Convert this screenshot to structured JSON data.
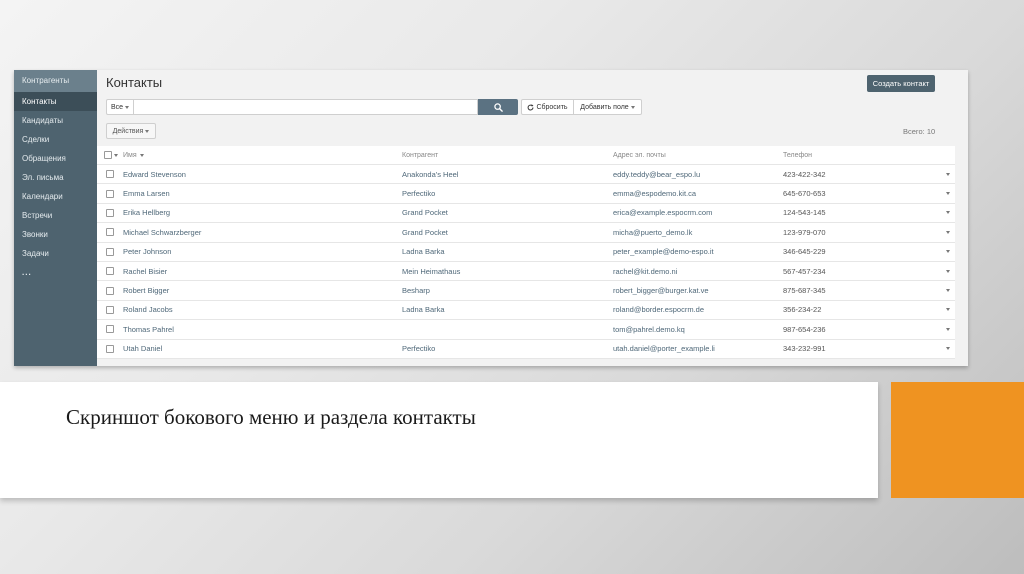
{
  "sidebar": {
    "items": [
      {
        "label": "Контрагенты"
      },
      {
        "label": "Контакты"
      },
      {
        "label": "Кандидаты"
      },
      {
        "label": "Сделки"
      },
      {
        "label": "Обращения"
      },
      {
        "label": "Эл. письма"
      },
      {
        "label": "Календари"
      },
      {
        "label": "Встречи"
      },
      {
        "label": "Звонки"
      },
      {
        "label": "Задачи"
      },
      {
        "label": "..."
      }
    ],
    "active_index": 1
  },
  "header": {
    "title": "Контакты",
    "create_button": "Создать контакт"
  },
  "search": {
    "filter": "Все",
    "value": "",
    "placeholder": "",
    "reset_label": "Сбросить",
    "add_field_label": "Добавить поле"
  },
  "actions_label": "Действия",
  "total_label": "Всего: 10",
  "table": {
    "columns": [
      "Имя",
      "Контрагент",
      "Адрес эл. почты",
      "Телефон"
    ],
    "rows": [
      {
        "name": "Edward Stevenson",
        "account": "Anakonda's Heel",
        "email": "eddy.teddy@bear_espo.lu",
        "phone": "423-422-342"
      },
      {
        "name": "Emma Larsen",
        "account": "Perfectiko",
        "email": "emma@espodemo.kit.ca",
        "phone": "645-670-653"
      },
      {
        "name": "Erika Hellberg",
        "account": "Grand Pocket",
        "email": "erica@example.espocrm.com",
        "phone": "124-543-145"
      },
      {
        "name": "Michael Schwarzberger",
        "account": "Grand Pocket",
        "email": "micha@puerto_demo.lk",
        "phone": "123-979-070"
      },
      {
        "name": "Peter Johnson",
        "account": "Ladna Barka",
        "email": "peter_example@demo-espo.it",
        "phone": "346-645-229"
      },
      {
        "name": "Rachel Bisier",
        "account": "Mein Heimathaus",
        "email": "rachel@kit.demo.ni",
        "phone": "567-457-234"
      },
      {
        "name": "Robert Bigger",
        "account": "Besharp",
        "email": "robert_bigger@burger.kat.ve",
        "phone": "875-687-345"
      },
      {
        "name": "Roland Jacobs",
        "account": "Ladna Barka",
        "email": "roland@border.espocrm.de",
        "phone": "356-234-22"
      },
      {
        "name": "Thomas Pahrel",
        "account": "",
        "email": "tom@pahrel.demo.kq",
        "phone": "987-654-236"
      },
      {
        "name": "Utah Daniel",
        "account": "Perfectiko",
        "email": "utah.daniel@porter_example.li",
        "phone": "343-232-991"
      }
    ]
  },
  "caption": "Скриншот бокового меню и раздела контакты",
  "colors": {
    "sidebar": "#4e636f",
    "sidebar_active": "#3c4e58",
    "primary_button": "#4e636f",
    "link": "#4f6879",
    "accent_orange": "#ef9321"
  },
  "icons": {
    "search": "search-icon",
    "reset": "refresh-icon",
    "dropdown": "caret-down-icon"
  }
}
